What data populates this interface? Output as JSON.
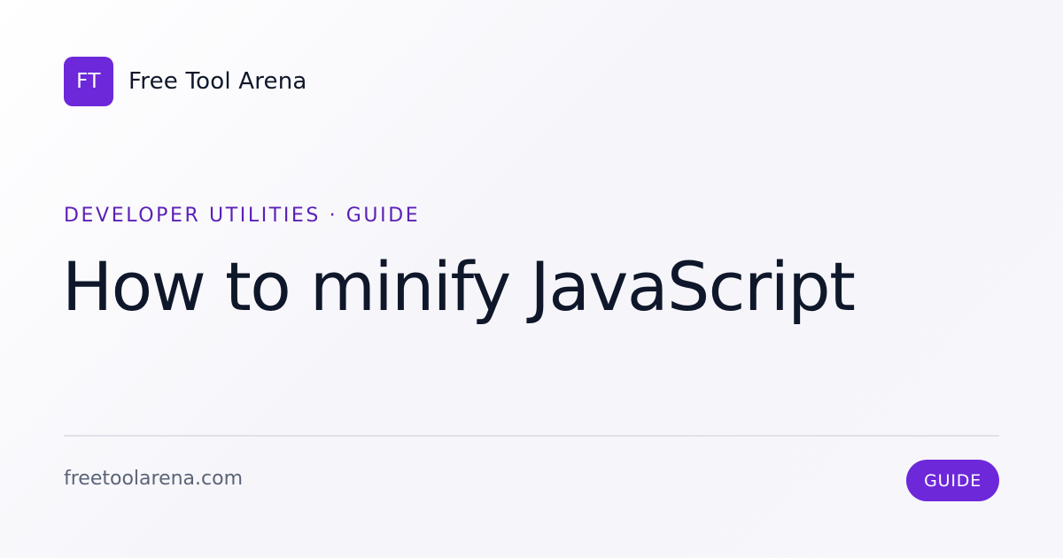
{
  "brand": {
    "logo_text": "FT",
    "name": "Free Tool Arena",
    "accent_color": "#6d28d9"
  },
  "category": "DEVELOPER UTILITIES · GUIDE",
  "title": "How to minify JavaScript",
  "footer": {
    "domain": "freetoolarena.com",
    "badge": "GUIDE"
  }
}
